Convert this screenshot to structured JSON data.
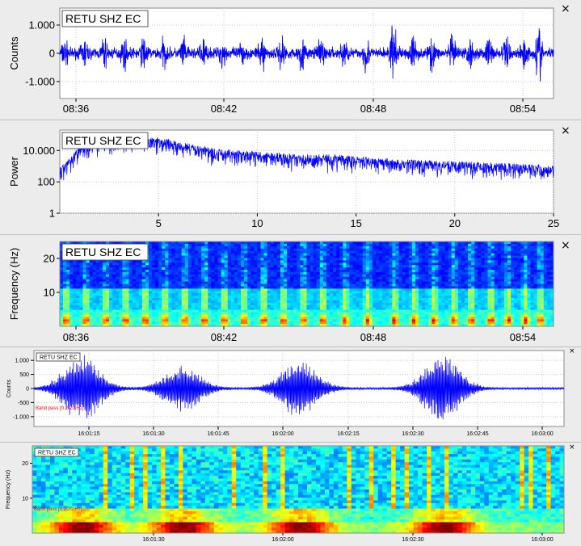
{
  "colors": {
    "trace": "#0000ff",
    "plot_bg": "#ffffff",
    "panel_bg": "#ececec",
    "grid": "#c8c8c8",
    "filter_text": "#ff0000"
  },
  "icons": {
    "close": "close-icon",
    "close_glyph": "×"
  },
  "chart_data": [
    {
      "type": "line",
      "title": "RETU SHZ EC",
      "ylabel": "Counts",
      "xlabel": "",
      "x_ticks": [
        "08:36",
        "08:42",
        "08:48",
        "08:54"
      ],
      "y_ticks": [
        "1.000",
        "0",
        "-1.000"
      ],
      "ylim": [
        -1600,
        1600
      ],
      "grid": true,
      "description_series": "seismogram amplitude vs time",
      "pulses": [
        {
          "t": 0.01,
          "amp": 560
        },
        {
          "t": 0.05,
          "amp": 620
        },
        {
          "t": 0.09,
          "amp": 640
        },
        {
          "t": 0.13,
          "amp": 590
        },
        {
          "t": 0.17,
          "amp": 700
        },
        {
          "t": 0.21,
          "amp": 560
        },
        {
          "t": 0.25,
          "amp": 610
        },
        {
          "t": 0.29,
          "amp": 620
        },
        {
          "t": 0.33,
          "amp": 600
        },
        {
          "t": 0.37,
          "amp": 640
        },
        {
          "t": 0.41,
          "amp": 700
        },
        {
          "t": 0.45,
          "amp": 720
        },
        {
          "t": 0.49,
          "amp": 640
        },
        {
          "t": 0.53,
          "amp": 680
        },
        {
          "t": 0.575,
          "amp": 720
        },
        {
          "t": 0.62,
          "amp": 760
        },
        {
          "t": 0.675,
          "amp": 1500
        },
        {
          "t": 0.715,
          "amp": 880
        },
        {
          "t": 0.755,
          "amp": 720
        },
        {
          "t": 0.795,
          "amp": 700
        },
        {
          "t": 0.83,
          "amp": 680
        },
        {
          "t": 0.87,
          "amp": 720
        },
        {
          "t": 0.905,
          "amp": 760
        },
        {
          "t": 0.94,
          "amp": 680
        },
        {
          "t": 0.97,
          "amp": 1400
        }
      ],
      "background_amp": 280
    },
    {
      "type": "line",
      "title": "RETU SHZ EC",
      "ylabel": "Power",
      "xlabel": "",
      "x_ticks": [
        "5",
        "10",
        "15",
        "20",
        "25"
      ],
      "xlim": [
        0,
        25
      ],
      "y_ticks": [
        "10.000",
        "100",
        "1"
      ],
      "y_scale": "log",
      "ylim": [
        1,
        200000
      ],
      "grid": true,
      "envelope": [
        {
          "x": 0.0,
          "y": 600
        },
        {
          "x": 0.6,
          "y": 3000
        },
        {
          "x": 1.0,
          "y": 15000
        },
        {
          "x": 2.0,
          "y": 30000
        },
        {
          "x": 3.0,
          "y": 40000
        },
        {
          "x": 4.0,
          "y": 45000
        },
        {
          "x": 5.0,
          "y": 50000
        },
        {
          "x": 6.0,
          "y": 25000
        },
        {
          "x": 7.0,
          "y": 15000
        },
        {
          "x": 8.0,
          "y": 9000
        },
        {
          "x": 10.0,
          "y": 6000
        },
        {
          "x": 12.0,
          "y": 4000
        },
        {
          "x": 14.0,
          "y": 4000
        },
        {
          "x": 16.0,
          "y": 2500
        },
        {
          "x": 18.0,
          "y": 1800
        },
        {
          "x": 20.0,
          "y": 1500
        },
        {
          "x": 22.0,
          "y": 1200
        },
        {
          "x": 24.0,
          "y": 900
        },
        {
          "x": 25.0,
          "y": 800
        }
      ]
    },
    {
      "type": "heatmap",
      "title": "RETU SHZ EC",
      "ylabel": "Frequency (Hz)",
      "xlabel": "",
      "x_ticks": [
        "08:36",
        "08:42",
        "08:48",
        "08:54"
      ],
      "y_ticks": [
        "20",
        "10"
      ],
      "ylim": [
        0,
        25
      ],
      "colormap": "jet"
    },
    {
      "type": "line",
      "title": "RETU SHZ EC",
      "ylabel": "Counts",
      "xlabel": "",
      "annotation": "Band pass [0.2-20 Hz]",
      "x_ticks": [
        "16:01:15",
        "16:01:30",
        "16:01:45",
        "16:02:00",
        "16:02:15",
        "16:02:30",
        "16:02:45",
        "16:03:00"
      ],
      "y_ticks": [
        "1.000",
        "500",
        "0",
        "-500",
        "-1.000"
      ],
      "ylim": [
        -1350,
        1350
      ],
      "grid": true,
      "bursts": [
        {
          "t": 0.09,
          "amp": 1200
        },
        {
          "t": 0.28,
          "amp": 800
        },
        {
          "t": 0.5,
          "amp": 1000
        },
        {
          "t": 0.77,
          "amp": 1200
        }
      ],
      "background_amp": 40
    },
    {
      "type": "heatmap",
      "title": "RETU SHZ EC",
      "ylabel": "Frequency (Hz)",
      "xlabel": "",
      "annotation": "Band pass [0.2-20 Hz]",
      "x_ticks": [
        "16:01:30",
        "16:02:00",
        "16:02:30",
        "16:03:00"
      ],
      "y_ticks": [
        "20",
        "10"
      ],
      "ylim": [
        0,
        25
      ],
      "colormap": "jet"
    }
  ]
}
